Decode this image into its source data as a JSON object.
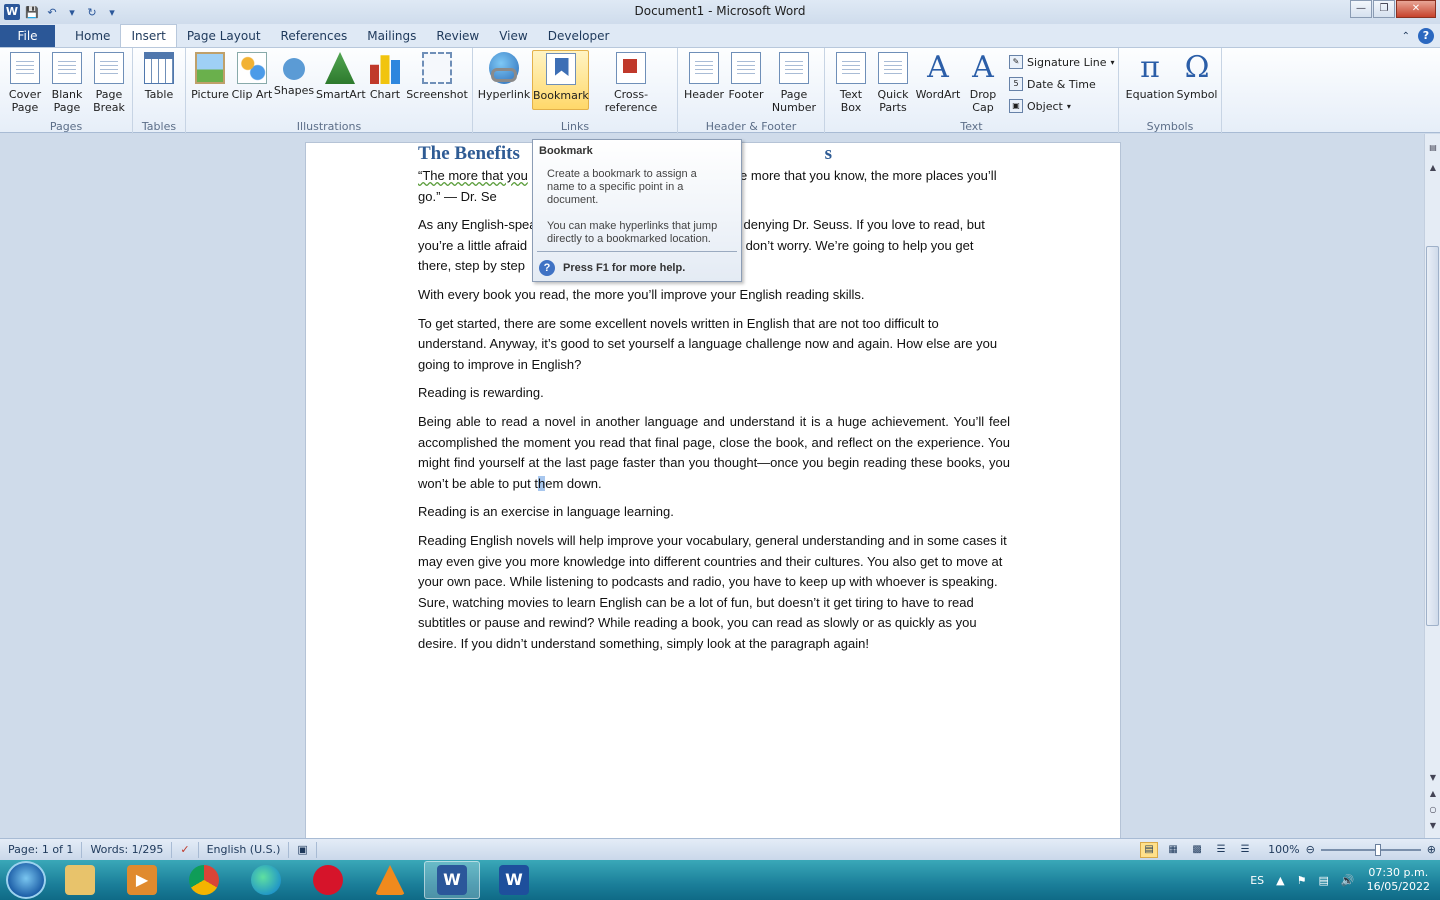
{
  "window": {
    "title": "Document1  -  Microsoft Word",
    "app_icon_letter": "W"
  },
  "tabs": [
    "File",
    "Home",
    "Insert",
    "Page Layout",
    "References",
    "Mailings",
    "Review",
    "View",
    "Developer"
  ],
  "active_tab": "Insert",
  "ribbon": {
    "pages": {
      "label": "Pages",
      "cover_page": "Cover Page",
      "blank_page": "Blank Page",
      "page_break": "Page Break"
    },
    "tables": {
      "label": "Tables",
      "table": "Table"
    },
    "illustrations": {
      "label": "Illustrations",
      "picture": "Picture",
      "clip_art": "Clip Art",
      "shapes": "Shapes",
      "smartart": "SmartArt",
      "chart": "Chart",
      "screenshot": "Screenshot"
    },
    "links": {
      "label": "Links",
      "hyperlink": "Hyperlink",
      "bookmark": "Bookmark",
      "cross_reference": "Cross-reference"
    },
    "header_footer": {
      "label": "Header & Footer",
      "header": "Header",
      "footer": "Footer",
      "page_number": "Page Number"
    },
    "text": {
      "label": "Text",
      "text_box": "Text Box",
      "quick_parts": "Quick Parts",
      "wordart": "WordArt",
      "drop_cap": "Drop Cap",
      "signature_line": "Signature Line",
      "date_time": "Date & Time",
      "object": "Object"
    },
    "symbols": {
      "label": "Symbols",
      "equation": "Equation",
      "symbol": "Symbol"
    }
  },
  "tooltip": {
    "title": "Bookmark",
    "line1": "Create a bookmark to assign a name to a specific point in a document.",
    "line2": "You can make hyperlinks that jump directly to a bookmarked location.",
    "help": "Press F1 for more help."
  },
  "document": {
    "heading_start": "The Benefits ",
    "heading_end": "s",
    "p1_start": "“The more that you",
    "p1_end": "he more that you know, the more places you’ll go.” — Dr. Se",
    "p2_start": "As any English-spea",
    "p2_mid": "denying Dr. Seuss. If you love to read, but you’re a little afraid",
    "p2_end": "h, don’t worry. We’re going to help you get there, step by step",
    "p3": "With every book you read, the more you’ll improve your English reading skills.",
    "p4": "To get started, there are some excellent novels written in English that are not too difficult to understand. Anyway, it’s good to set yourself a language challenge now and again. How else are you going to improve in English?",
    "p5": "Reading is rewarding.",
    "p6_before": "Being able to read a novel in another language and understand it is a huge achievement. You’ll feel accomplished the moment you read that final page, close the book, and reflect on the experience. You might find yourself at the last page faster than you thought—once you begin reading these books, you won’t be able to put t",
    "p6_sel": "h",
    "p6_after": "em down.",
    "p7": "Reading is an exercise in language learning.",
    "p8": "Reading English novels will help improve your vocabulary, general understanding and in some cases it may even give you more knowledge into different countries and their cultures. You also get to move at your own pace. While listening to podcasts and radio, you have to keep up with whoever is speaking. Sure, watching movies to learn English can be a lot of fun, but doesn’t it get tiring to have to read subtitles or pause and rewind? While reading a book, you can read as slowly or as quickly as you desire. If you didn’t understand something, simply look at the paragraph again!"
  },
  "statusbar": {
    "page": "Page: 1 of 1",
    "words": "Words: 1/295",
    "language": "English (U.S.)",
    "zoom": "100%"
  },
  "taskbar": {
    "language": "ES",
    "time": "07:30 p.m.",
    "date": "16/05/2022"
  }
}
